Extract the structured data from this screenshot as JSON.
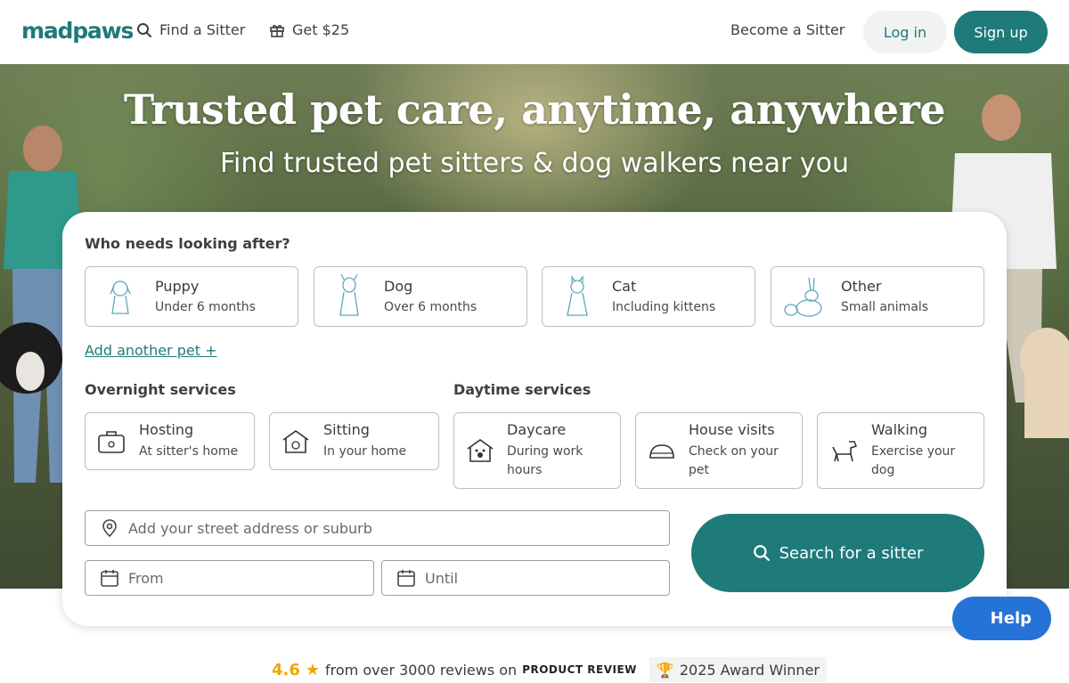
{
  "header": {
    "logo": "madpaws",
    "find_sitter": "Find a Sitter",
    "get_reward": "Get $25",
    "become_sitter": "Become a Sitter",
    "login": "Log in",
    "signup": "Sign up"
  },
  "hero": {
    "title": "Trusted pet care, anytime, anywhere",
    "subtitle": "Find trusted pet sitters & dog walkers near you"
  },
  "search": {
    "who_label": "Who needs looking after?",
    "pets": [
      {
        "name": "Puppy",
        "desc": "Under 6 months"
      },
      {
        "name": "Dog",
        "desc": "Over 6 months"
      },
      {
        "name": "Cat",
        "desc": "Including kittens"
      },
      {
        "name": "Other",
        "desc": "Small animals"
      }
    ],
    "add_pet": "Add another pet +",
    "overnight_label": "Overnight services",
    "daytime_label": "Daytime services",
    "overnight": [
      {
        "name": "Hosting",
        "desc": "At sitter's home"
      },
      {
        "name": "Sitting",
        "desc": "In your home"
      }
    ],
    "daytime": [
      {
        "name": "Daycare",
        "desc": "During work hours"
      },
      {
        "name": "House visits",
        "desc": "Check on your pet"
      },
      {
        "name": "Walking",
        "desc": "Exercise your dog"
      }
    ],
    "address_placeholder": "Add your street address or suburb",
    "from_placeholder": "From",
    "until_placeholder": "Until",
    "search_button": "Search for a sitter"
  },
  "help": {
    "label": "Help"
  },
  "reviews": {
    "rating": "4.6",
    "text": "from over 3000 reviews on",
    "source": "PRODUCT REVIEW",
    "award": "2025 Award Winner"
  },
  "colors": {
    "brand": "#1f7a7a",
    "help": "#2673d8",
    "rating": "#f0a500"
  }
}
